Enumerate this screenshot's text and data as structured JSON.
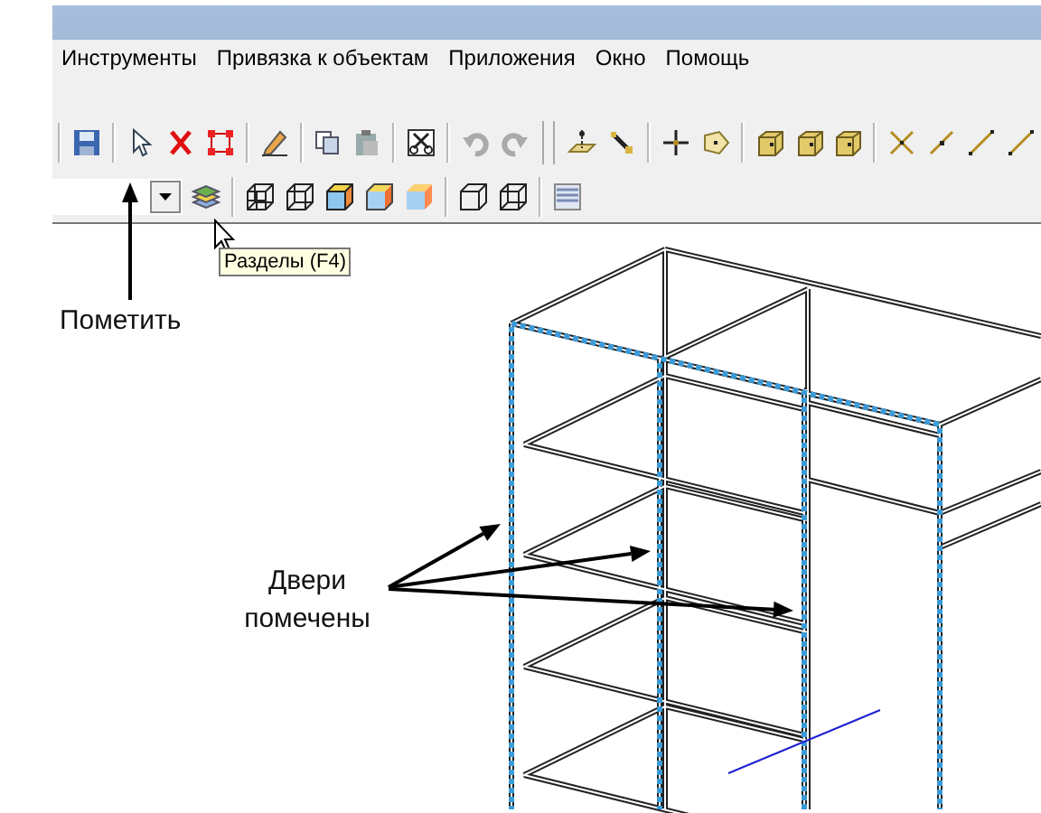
{
  "menu": [
    {
      "label": "Инструменты"
    },
    {
      "label": "Привязка к объектам"
    },
    {
      "label": "Приложения"
    },
    {
      "label": "Окно"
    },
    {
      "label": "Помощь"
    }
  ],
  "tooltip": {
    "text": "Разделы (F4)"
  },
  "annotations": [
    {
      "kind": "mark",
      "text": "Пометить"
    },
    {
      "kind": "doors",
      "text": "Двери помечены"
    }
  ]
}
